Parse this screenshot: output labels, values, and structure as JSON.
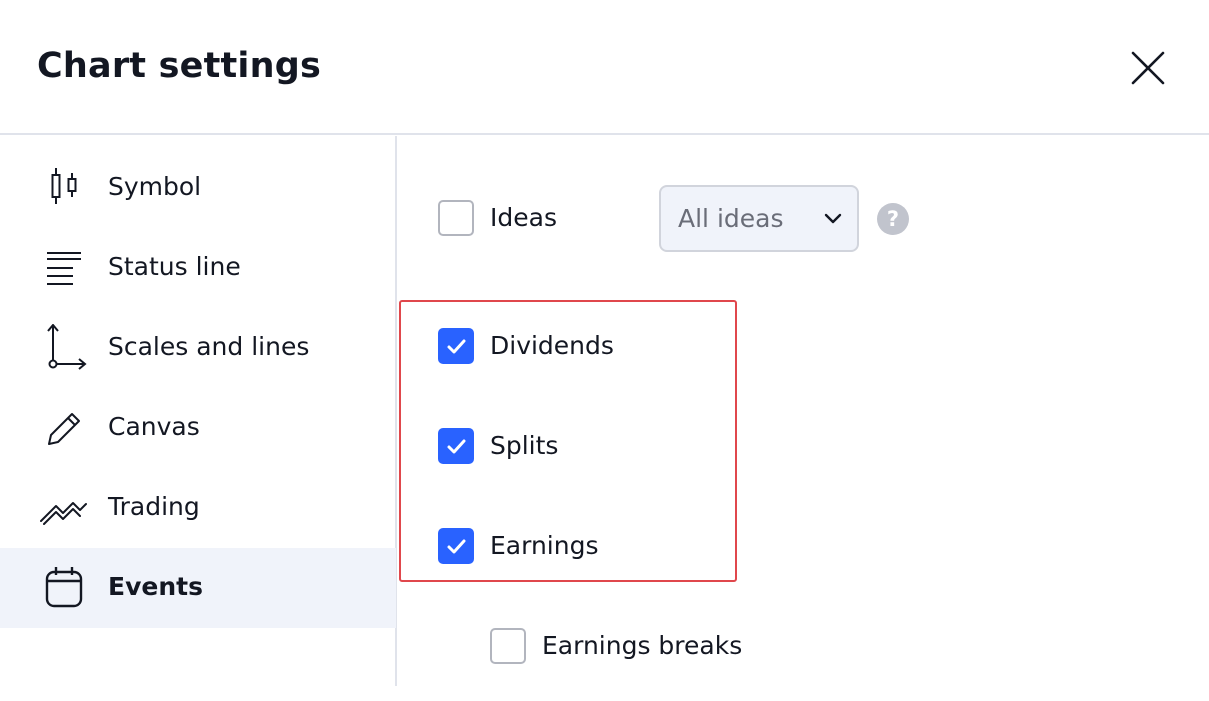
{
  "dialog": {
    "title": "Chart settings",
    "close_icon": "close-icon"
  },
  "sidebar": {
    "items": [
      {
        "label": "Symbol",
        "icon": "candlestick-icon",
        "active": false
      },
      {
        "label": "Status line",
        "icon": "status-line-icon",
        "active": false
      },
      {
        "label": "Scales and lines",
        "icon": "scales-icon",
        "active": false
      },
      {
        "label": "Canvas",
        "icon": "pencil-icon",
        "active": false
      },
      {
        "label": "Trading",
        "icon": "trading-icon",
        "active": false
      },
      {
        "label": "Events",
        "icon": "calendar-icon",
        "active": true
      }
    ]
  },
  "events": {
    "ideas": {
      "label": "Ideas",
      "checked": false
    },
    "ideas_select": {
      "value": "All ideas"
    },
    "help_icon": "?",
    "dividends": {
      "label": "Dividends",
      "checked": true
    },
    "splits": {
      "label": "Splits",
      "checked": true
    },
    "earnings": {
      "label": "Earnings",
      "checked": true
    },
    "earnings_breaks": {
      "label": "Earnings breaks",
      "checked": false
    }
  },
  "colors": {
    "accent": "#2962ff",
    "highlight_border": "#e0474c",
    "active_bg": "#f0f3fa",
    "divider": "#e0e3eb"
  }
}
